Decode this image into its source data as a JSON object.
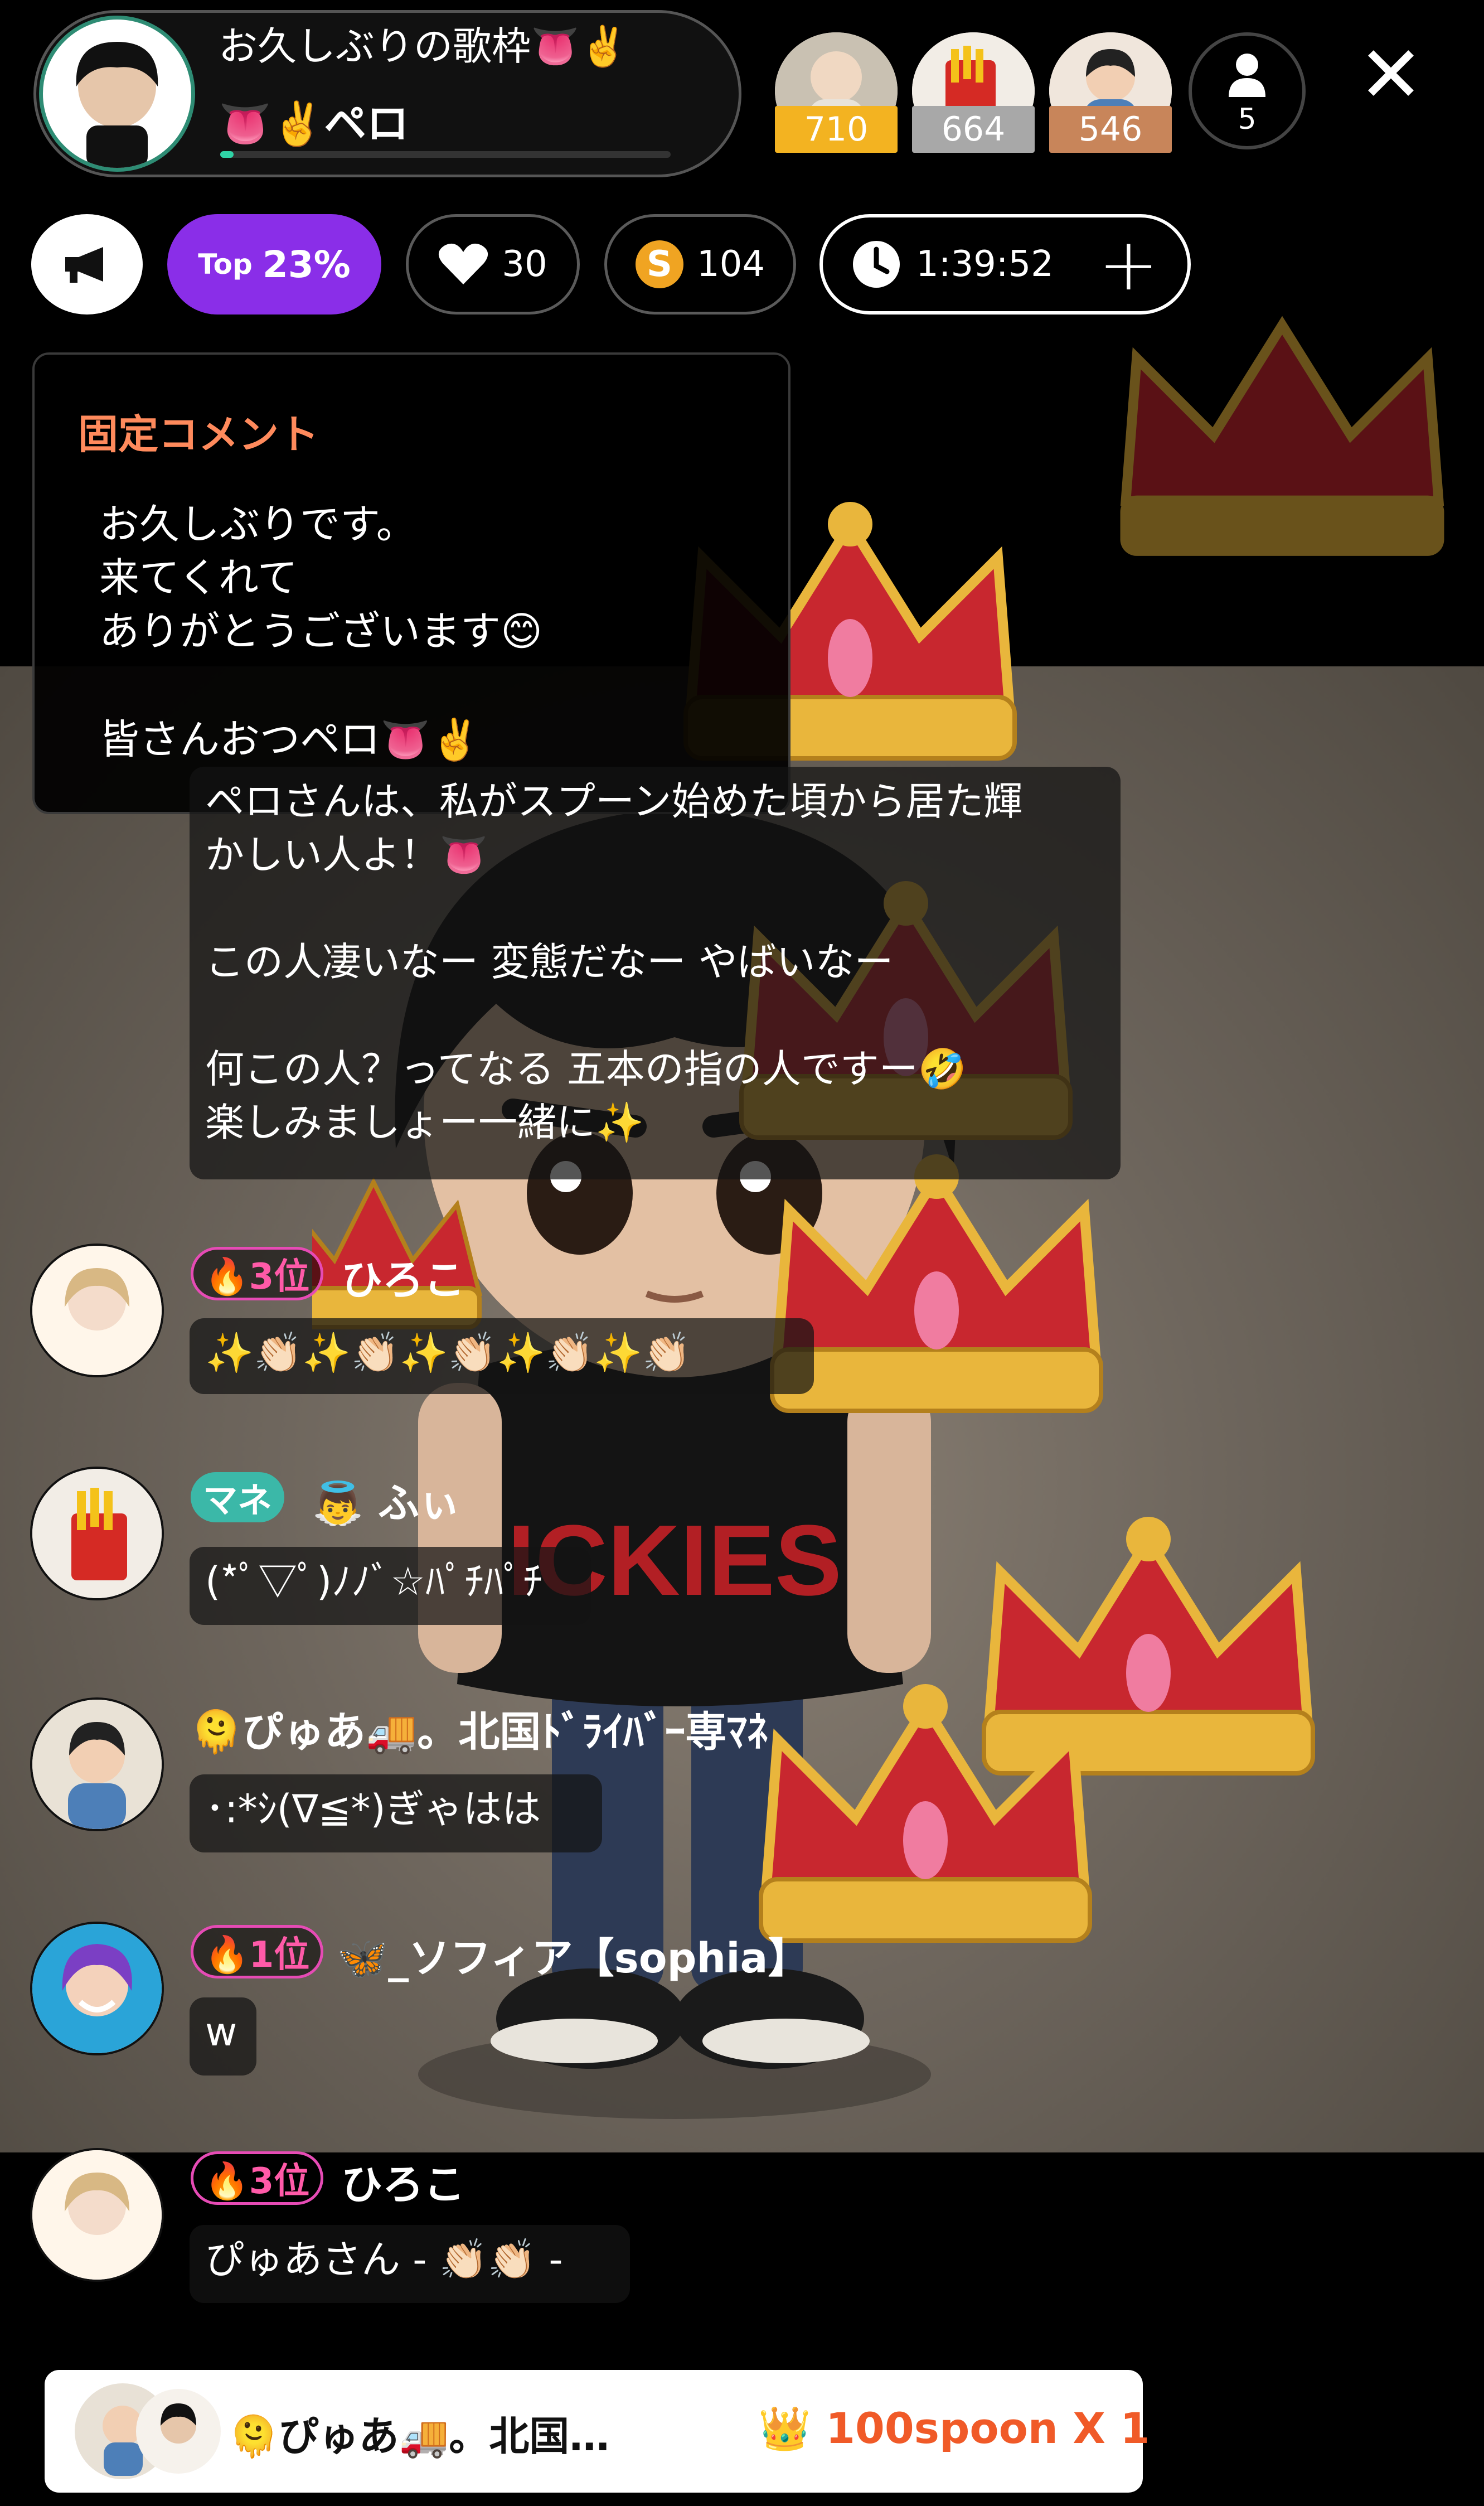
{
  "header": {
    "title": "お久しぶりの歌枠👅✌️",
    "host_name": "👅✌️ペロ",
    "progress_fraction": 0.03,
    "top_fans": [
      {
        "count": "710",
        "badge_color": "#f3b321"
      },
      {
        "count": "664",
        "badge_color": "#a8a8a8"
      },
      {
        "count": "546",
        "badge_color": "#c8855a"
      }
    ],
    "viewer_count": "5",
    "close_icon": "✕"
  },
  "stats": {
    "top_prefix": "Top",
    "top_value": "23%",
    "hearts": "30",
    "spoons": "104",
    "spoon_symbol": "S",
    "timer": "1:39:52",
    "add_symbol": "+"
  },
  "pinned_comment": {
    "label": "固定コメント",
    "lines": [
      "お久しぶりです。",
      "来てくれて",
      "ありがとうございます😊",
      "皆さんおつペロ👅✌️"
    ]
  },
  "chat": [
    {
      "message_lines": [
        "ペロさんは、私がスプーン始めた頃から居た輝",
        "かしい人よ！👅",
        "",
        "この人凄いなー 変態だなー やばいなー",
        "",
        "何この人？ってなる 五本の指の人ですー🤣",
        "楽しみましょー一緒に✨"
      ]
    },
    {
      "rank": "🔥3位",
      "name": "ひろこ",
      "message": "✨👏🏻✨👏🏻✨👏🏻✨👏🏻✨👏🏻"
    },
    {
      "badge": "マネ",
      "name": "👼 ふぃ",
      "message": "(*ﾟ▽ﾟ)ﾉﾉﾞ☆ﾊﾟﾁﾊﾟﾁ"
    },
    {
      "name": "🫠ぴゅあ🚚。北国ﾄﾞﾗｲﾊﾞｰ専ﾏﾈ",
      "message": "･:*ｼ(∇≦*)ぎゃはは"
    },
    {
      "rank": "🔥1位",
      "name": "🦋_ソフィア【sophia】",
      "message": "w"
    },
    {
      "rank": "🔥3位",
      "name": "ひろこ",
      "message": "ぴゅあさん - 👏🏻👏🏻 -"
    }
  ],
  "gift_toast": {
    "sender": "🫠ぴゅあ🚚。北国…",
    "gift": "👑 100spoon X 1"
  },
  "colors": {
    "accent_purple": "#8a2ee8",
    "pinned_label": "#ff8a5c",
    "rank_pink": "#ff5aa8",
    "mane_teal": "#3bb8a8",
    "gift_orange": "#f05a28"
  }
}
